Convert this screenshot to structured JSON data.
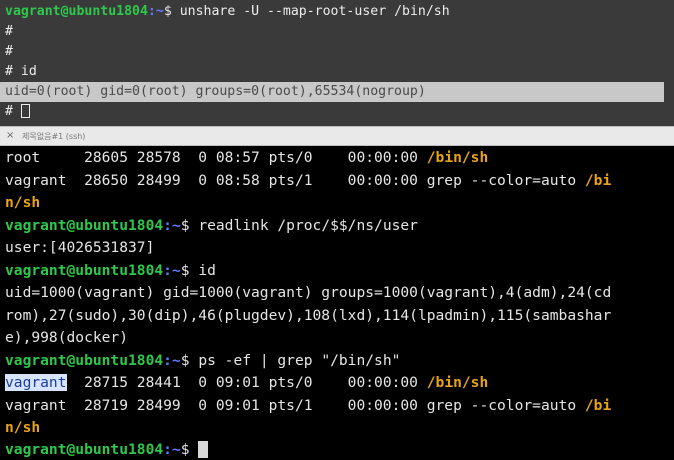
{
  "top_pane": {
    "prompt_user": "vagrant@ubuntu1804",
    "prompt_path": ":~",
    "prompt_symbol": "$ ",
    "command": "unshare -U --map-root-user /bin/sh",
    "line2": "#",
    "line3": "#",
    "line4_prompt": "# ",
    "line4_cmd": "id",
    "output": "uid=0(root) gid=0(root) groups=0(root),65534(nogroup)",
    "line6_prompt": "# "
  },
  "tab": {
    "close": "×",
    "title": "제목없음#1 (ssh)"
  },
  "bottom_pane": {
    "ps1_a": "root     28605 28578  0 08:57 pts/0    00:00:00 ",
    "ps1_b": "/bin/sh",
    "ps2_a": "vagrant  28650 28499  0 08:58 pts/1    00:00:00 grep --color=auto ",
    "ps2_b": "/bi",
    "ps2_c": "n/sh",
    "prompt_user": "vagrant@ubuntu1804",
    "prompt_path": ":~",
    "prompt_symbol": "$ ",
    "cmd_readlink": "readlink /proc/$$/ns/user",
    "out_readlink": "user:[4026531837]",
    "cmd_id": "id",
    "out_id_1": "uid=1000(vagrant) gid=1000(vagrant) groups=1000(vagrant),4(adm),24(cd",
    "out_id_2": "rom),27(sudo),30(dip),46(plugdev),108(lxd),114(lpadmin),115(sambashar",
    "out_id_3": "e),998(docker)",
    "cmd_ps": "ps -ef | grep \"/bin/sh\"",
    "ps3_user": "vagrant",
    "ps3_a": "  28715 28441  0 09:01 pts/0    00:00:00 ",
    "ps3_b": "/bin/sh",
    "ps4_a": "vagrant  28719 28499  0 09:01 pts/1    00:00:00 grep --color=auto ",
    "ps4_b": "/bi",
    "ps4_c": "n/sh"
  }
}
